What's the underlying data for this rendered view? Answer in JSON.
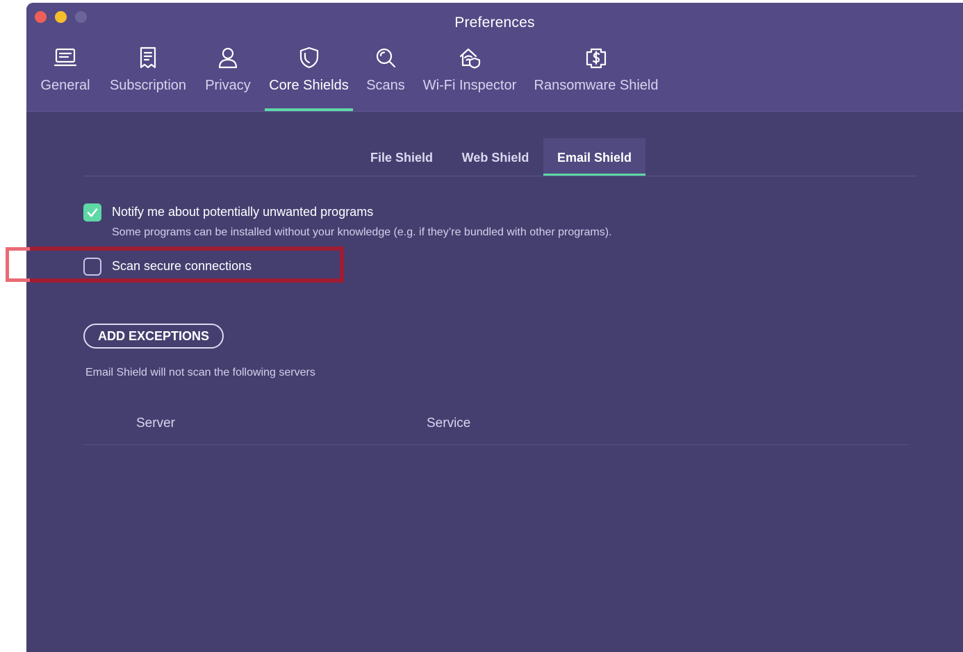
{
  "window": {
    "title": "Preferences"
  },
  "toolbar": {
    "tabs": [
      {
        "label": "General",
        "icon": "monitor-icon"
      },
      {
        "label": "Subscription",
        "icon": "receipt-icon"
      },
      {
        "label": "Privacy",
        "icon": "person-icon"
      },
      {
        "label": "Core Shields",
        "icon": "shield-icon"
      },
      {
        "label": "Scans",
        "icon": "search-icon"
      },
      {
        "label": "Wi-Fi Inspector",
        "icon": "wifi-house-icon"
      },
      {
        "label": "Ransomware Shield",
        "icon": "dollar-shield-icon"
      }
    ],
    "active_tab": "Core Shields"
  },
  "subtabs": {
    "items": [
      "File Shield",
      "Web Shield",
      "Email Shield"
    ],
    "active": "Email Shield"
  },
  "options": {
    "pup": {
      "label": "Notify me about potentially unwanted programs",
      "description": "Some programs can be installed without your knowledge (e.g. if they’re bundled with other programs).",
      "checked": true
    },
    "secure": {
      "label": "Scan secure connections",
      "checked": false
    }
  },
  "exceptions": {
    "button_label": "ADD EXCEPTIONS",
    "note": "Email Shield will not scan the following servers",
    "columns": [
      "Server",
      "Service"
    ]
  },
  "colors": {
    "accent": "#5fd8a6",
    "background": "#453f70",
    "header": "#544a86",
    "highlight": "#b82a3c"
  }
}
